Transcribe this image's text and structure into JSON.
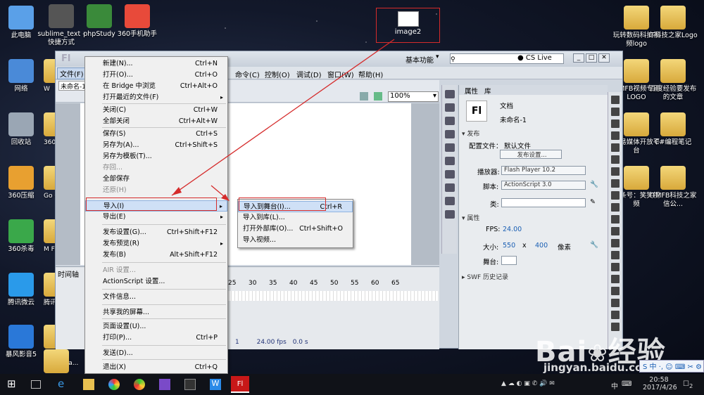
{
  "desktop": {
    "icons_left": [
      {
        "label": "此电脑",
        "color": "#5aa0e8"
      },
      {
        "label": "网络",
        "color": "#4a8ad8"
      },
      {
        "label": "回收站",
        "color": "#9aa6b4"
      },
      {
        "label": "360压缩",
        "color": "#e8a030"
      },
      {
        "label": "360杀毒",
        "color": "#3aa84a"
      },
      {
        "label": "腾讯微云",
        "color": "#2a9aea"
      },
      {
        "label": "暴风影音5",
        "color": "#2a78d8"
      }
    ],
    "icons_col2": [
      {
        "label": "sublime_text - 快捷方式",
        "color": "#555"
      },
      {
        "label": "phpStudy",
        "color": "#3a8a3a"
      },
      {
        "label": "360手机助手",
        "color": "#e84a3a"
      }
    ],
    "icons_partial": [
      {
        "label": "W"
      },
      {
        "label": "360"
      },
      {
        "label": "Go Ch"
      },
      {
        "label": "M Fi"
      },
      {
        "label": "腾讯"
      },
      {
        "label": "Video Waterma..."
      },
      {
        "label": "FL"
      }
    ],
    "icons_right": [
      {
        "label": "玩转数码科技视频logo"
      },
      {
        "label": "IT科技之家Logo"
      },
      {
        "label": "ITMFB视频专用LOGO"
      },
      {
        "label": "百度经验要发布的文章"
      },
      {
        "label": "网易媒体开放平台"
      },
      {
        "label": "C#编程笔记"
      },
      {
        "label": "头条号：笑笑视频"
      },
      {
        "label": "ITMFB科技之家信公..."
      }
    ],
    "image2_label": "image2"
  },
  "app": {
    "logo": "Fl",
    "workspace": "基本功能",
    "cs_live": "CS Live",
    "doc_tab": "未命名-1",
    "menus": [
      "文件(F)",
      "命令(C)",
      "控制(O)",
      "调试(D)",
      "窗口(W)",
      "帮助(H)"
    ],
    "zoom": "100%",
    "timeline_tab": "时间轴",
    "ruler": [
      "25",
      "30",
      "35",
      "40",
      "45",
      "50",
      "55",
      "60",
      "65"
    ],
    "tl_status": [
      "1",
      "24.00 fps",
      "0.0 s"
    ]
  },
  "file_menu": {
    "items": [
      {
        "label": "新建(N)...",
        "sc": "Ctrl+N"
      },
      {
        "label": "打开(O)...",
        "sc": "Ctrl+O"
      },
      {
        "label": "在 Bridge 中浏览",
        "sc": "Ctrl+Alt+O"
      },
      {
        "label": "打开最近的文件(F)",
        "sc": "",
        "sub": true
      },
      {
        "label": "关闭(C)",
        "sc": "Ctrl+W"
      },
      {
        "label": "全部关闭",
        "sc": "Ctrl+Alt+W"
      },
      {
        "label": "保存(S)",
        "sc": "Ctrl+S"
      },
      {
        "label": "另存为(A)...",
        "sc": "Ctrl+Shift+S"
      },
      {
        "label": "另存为模板(T)...",
        "sc": ""
      },
      {
        "label": "存回...",
        "sc": "",
        "dis": true
      },
      {
        "label": "全部保存",
        "sc": ""
      },
      {
        "label": "还原(H)",
        "sc": "",
        "dis": true
      },
      {
        "label": "导入(I)",
        "sc": "",
        "sub": true,
        "hl": true
      },
      {
        "label": "导出(E)",
        "sc": "",
        "sub": true
      },
      {
        "label": "发布设置(G)...",
        "sc": "Ctrl+Shift+F12"
      },
      {
        "label": "发布预览(R)",
        "sc": "",
        "sub": true
      },
      {
        "label": "发布(B)",
        "sc": "Alt+Shift+F12"
      },
      {
        "label": "AIR 设置...",
        "sc": "",
        "dis": true
      },
      {
        "label": "ActionScript 设置...",
        "sc": ""
      },
      {
        "label": "文件信息...",
        "sc": ""
      },
      {
        "label": "共享我的屏幕...",
        "sc": ""
      },
      {
        "label": "页面设置(U)...",
        "sc": ""
      },
      {
        "label": "打印(P)...",
        "sc": "Ctrl+P"
      },
      {
        "label": "发送(D)...",
        "sc": ""
      },
      {
        "label": "退出(X)",
        "sc": "Ctrl+Q"
      }
    ]
  },
  "import_menu": {
    "items": [
      {
        "label": "导入到舞台(I)...",
        "sc": "Ctrl+R",
        "hl": true
      },
      {
        "label": "导入到库(L)...",
        "sc": ""
      },
      {
        "label": "打开外部库(O)...",
        "sc": "Ctrl+Shift+O"
      },
      {
        "label": "导入视频...",
        "sc": ""
      }
    ]
  },
  "props": {
    "tabs": [
      "属性",
      "库"
    ],
    "doc_type": "文档",
    "doc_name": "未命名-1",
    "doc_icon": "Fl",
    "publish_hdr": "发布",
    "profile_label": "配置文件：",
    "profile_value": "默认文件",
    "publish_settings": "发布设置...",
    "player_label": "播放器:",
    "player_value": "Flash Player 10.2",
    "script_label": "脚本:",
    "script_value": "ActionScript 3.0",
    "class_label": "类:",
    "prop_hdr": "属性",
    "fps_label": "FPS:",
    "fps_value": "24.00",
    "size_label": "大小:",
    "width": "550",
    "x": "x",
    "height": "400",
    "unit": "像素",
    "stage_label": "舞台:",
    "swf_hdr": "SWF 历史记录"
  },
  "taskbar": {
    "time": "20:58",
    "date": "2017/4/26",
    "ime": "中",
    "notify": "2"
  },
  "watermark": {
    "brand": "Bai",
    "brand2": "经验",
    "url": "jingyan.baidu.com"
  }
}
